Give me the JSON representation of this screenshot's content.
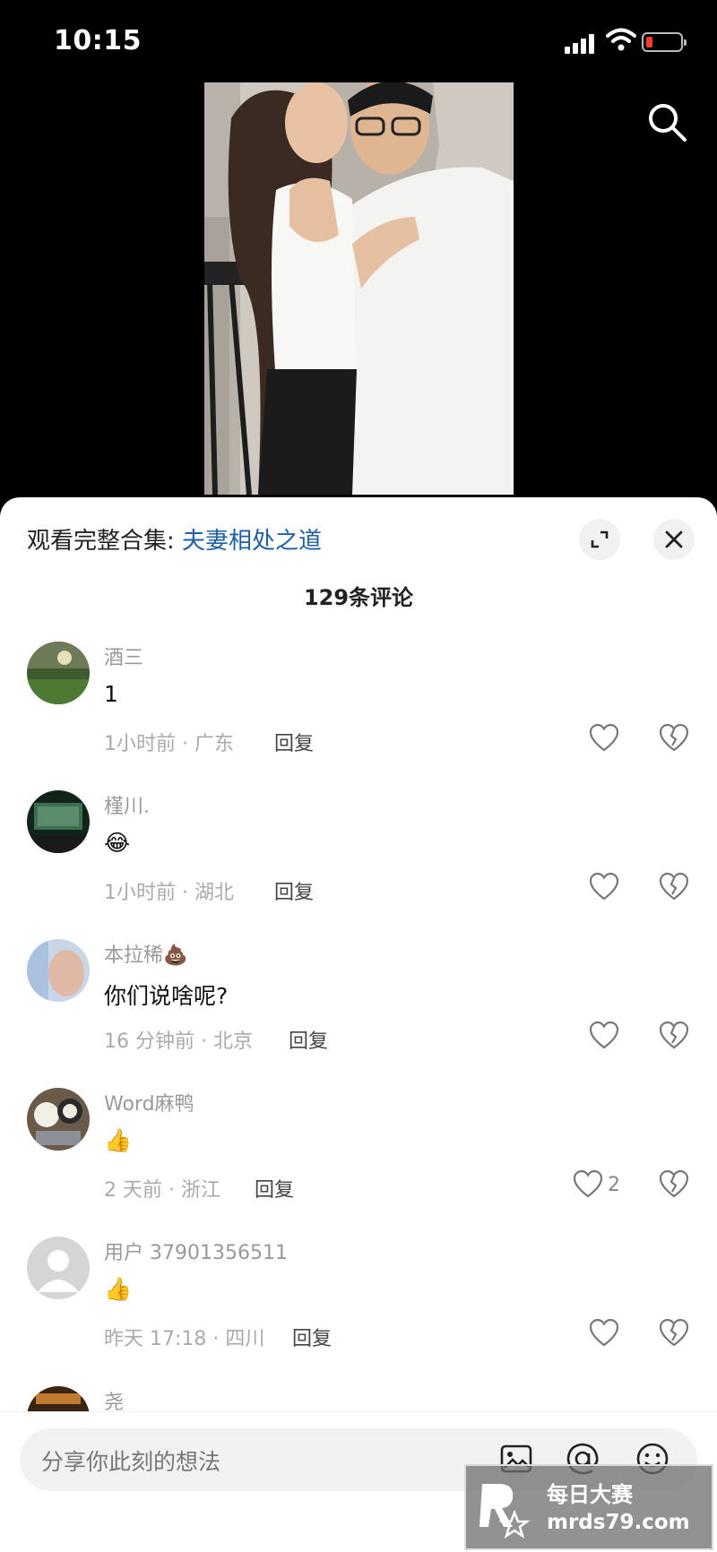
{
  "status": {
    "time": "10:15"
  },
  "video": {
    "search_icon": "search-icon"
  },
  "sheet": {
    "collection_prefix": "观看完整合集: ",
    "collection_link": "夫妻相处之道",
    "comment_count": "129条评论",
    "reply_label": "回复"
  },
  "comments": [
    {
      "name": "酒三",
      "text": "1",
      "meta": "1小时前 · 广东",
      "likes": ""
    },
    {
      "name": "槿川.",
      "text": "😂",
      "meta": "1小时前 · 湖北",
      "likes": ""
    },
    {
      "name": "本拉稀💩",
      "text": "你们说啥呢?",
      "meta": "16 分钟前 · 北京",
      "likes": ""
    },
    {
      "name": "Word麻鸭",
      "text": "👍",
      "meta": "2 天前 · 浙江",
      "likes": "2"
    },
    {
      "name": "用户 37901356511",
      "text": "👍",
      "meta": "昨天 17:18 · 四川",
      "likes": ""
    },
    {
      "name": "尧",
      "text": "",
      "meta": "",
      "likes": ""
    }
  ],
  "input": {
    "placeholder": "分享你此刻的想法"
  },
  "watermark": {
    "line1": "每日大赛",
    "line2": "mrds79.com"
  },
  "colors": {
    "link": "#1f5fa8",
    "accent_battery_low": "#ff3b30"
  }
}
